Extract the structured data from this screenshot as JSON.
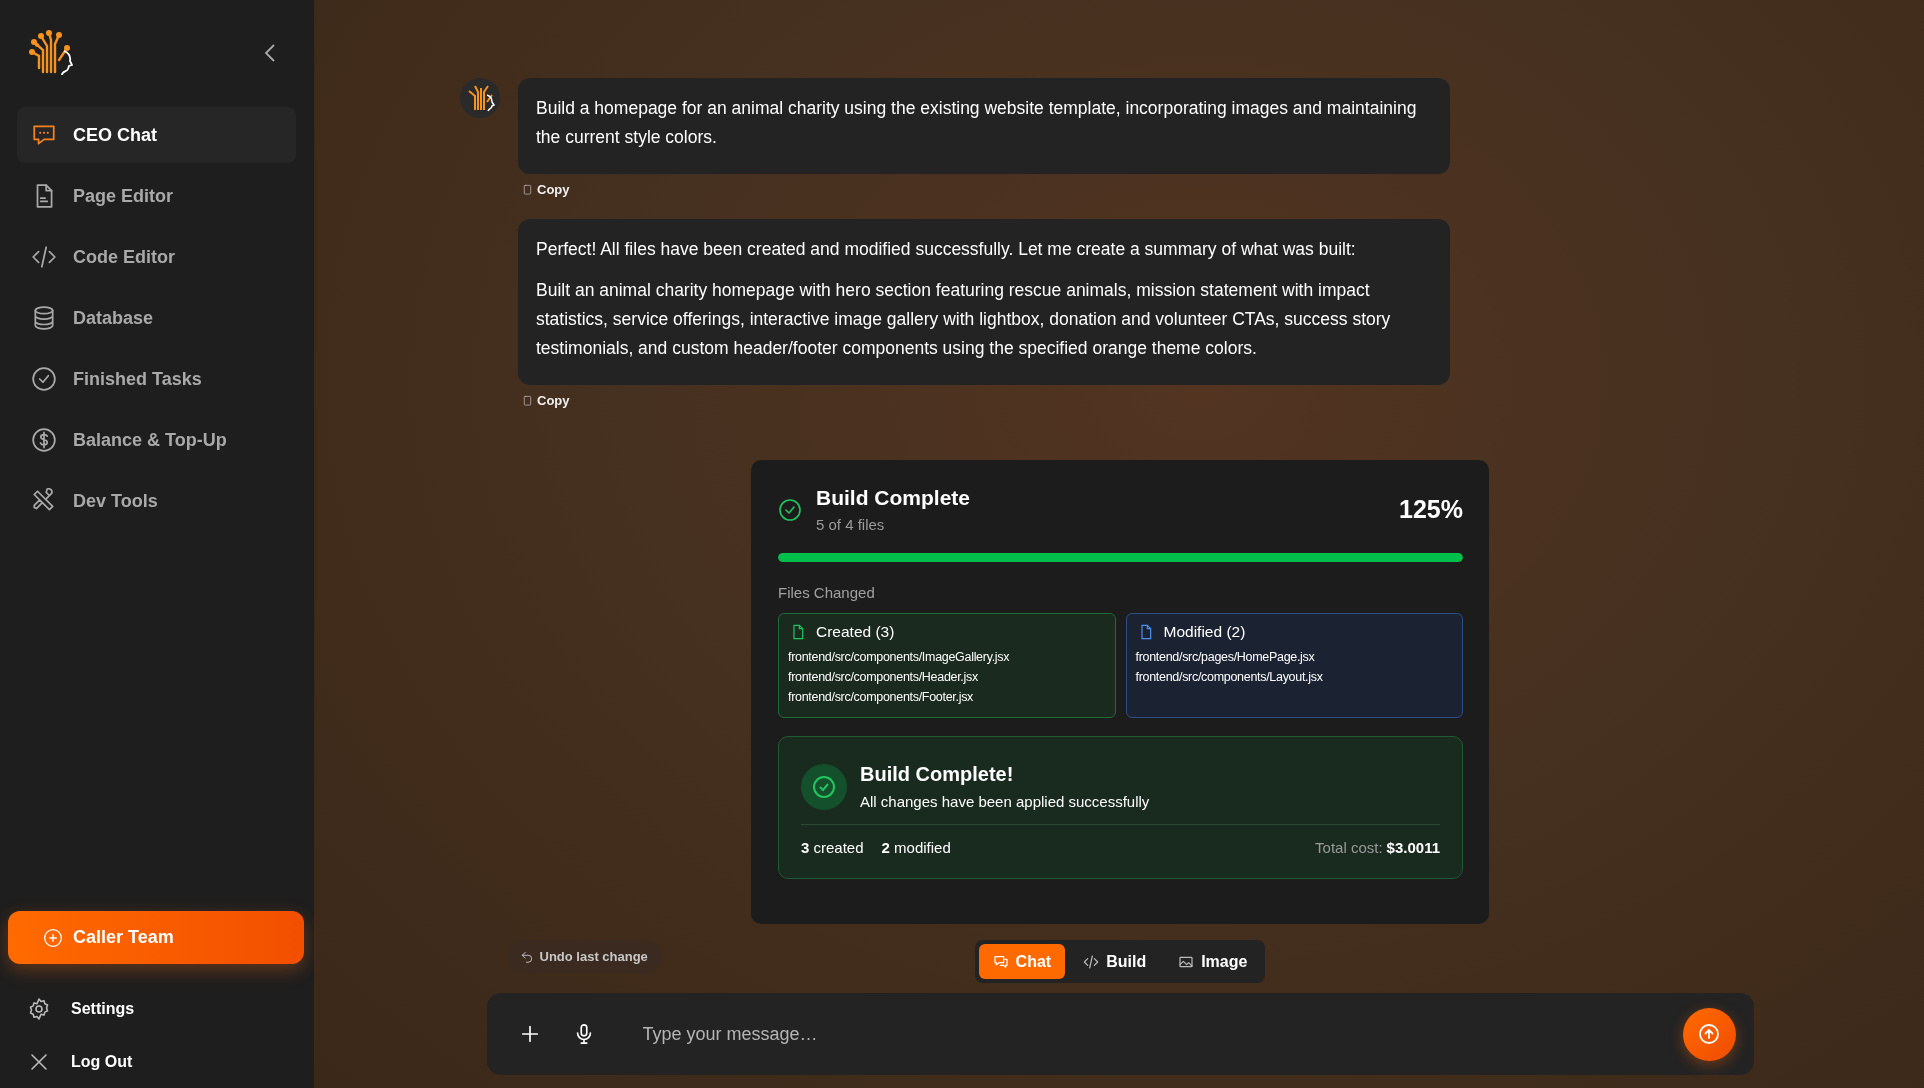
{
  "sidebar": {
    "items": [
      {
        "label": "CEO Chat",
        "selected": true
      },
      {
        "label": "Page Editor",
        "selected": false
      },
      {
        "label": "Code Editor",
        "selected": false
      },
      {
        "label": "Database",
        "selected": false
      },
      {
        "label": "Finished Tasks",
        "selected": false
      },
      {
        "label": "Balance & Top-Up",
        "selected": false
      },
      {
        "label": "Dev Tools",
        "selected": false
      }
    ],
    "primary_button": "Caller Team",
    "footer_items": [
      {
        "label": "Settings"
      },
      {
        "label": "Log Out"
      }
    ]
  },
  "messages": [
    {
      "paragraphs": [
        "Build a homepage for an animal charity using the existing website template, incorporating images and maintaining the current style colors."
      ],
      "avatar": true,
      "copy": "Copy"
    },
    {
      "paragraphs": [
        "Perfect! All files have been created and modified successfully. Let me create a summary of what was built:",
        "Built an animal charity homepage with hero section featuring rescue animals, mission statement with impact statistics, service offerings, interactive image gallery with lightbox, donation and volunteer CTAs, success story testimonials, and custom header/footer components using the specified orange theme colors."
      ],
      "avatar": false,
      "copy": "Copy"
    }
  ],
  "build": {
    "title": "Build Complete",
    "subtitle": "5 of 4 files",
    "percent": "125%",
    "level": 1.0,
    "files_heading": "Files Changed",
    "groups": [
      {
        "kind": "created",
        "title": "Created (3)",
        "files": [
          "frontend/src/components/ImageGallery.jsx",
          "frontend/src/components/Header.jsx",
          "frontend/src/components/Footer.jsx"
        ]
      },
      {
        "kind": "modified",
        "title": "Modified (2)",
        "files": [
          "frontend/src/pages/HomePage.jsx",
          "frontend/src/components/Layout.jsx"
        ]
      }
    ],
    "summary": {
      "title": "Build Complete!",
      "text": "All changes have been applied successfully",
      "stats": [
        "**3** created",
        "**2** modified"
      ],
      "cost_label": "Total cost:",
      "cost": "$3.0011"
    }
  },
  "undo_button": "Undo last change",
  "modes": [
    {
      "label": "Chat",
      "selected": true
    },
    {
      "label": "Build",
      "selected": false
    },
    {
      "label": "Image",
      "selected": false
    }
  ],
  "input": {
    "placeholder": "Type your message…"
  }
}
